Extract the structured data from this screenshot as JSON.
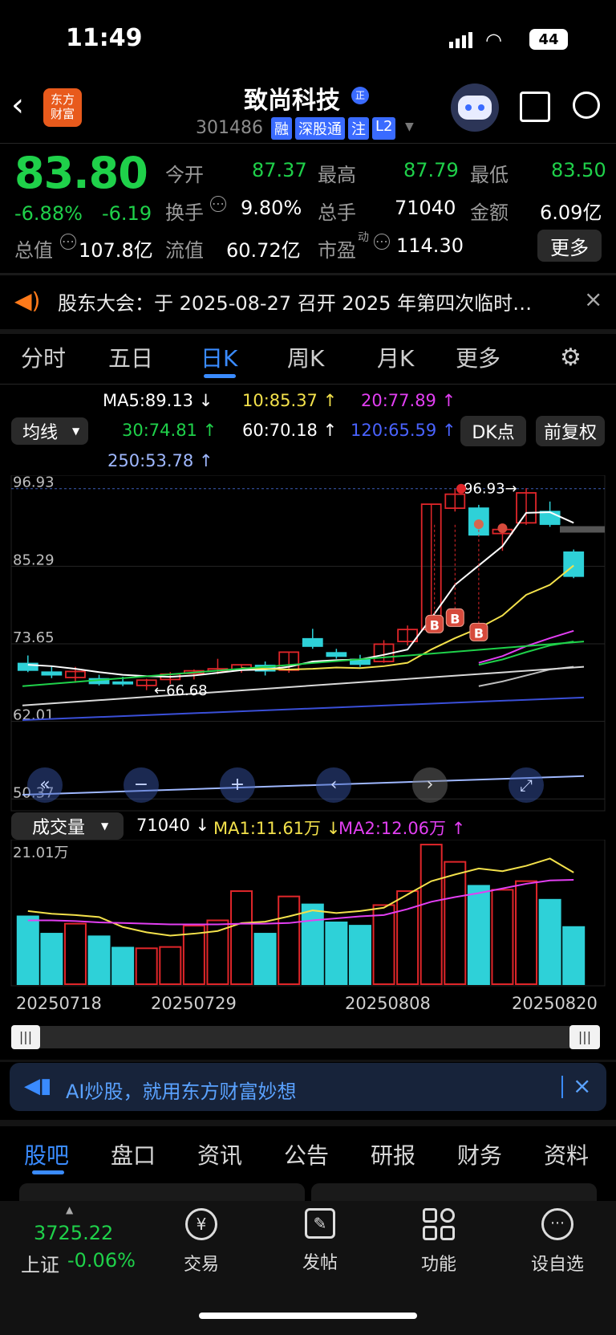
{
  "status": {
    "time": "11:49",
    "battery": "44"
  },
  "header": {
    "title": "致尚科技",
    "code": "301486",
    "tags": [
      "融",
      "深股通",
      "注",
      "L2"
    ],
    "logo_text": "东方\n财富"
  },
  "quote": {
    "price": "83.80",
    "pct": "-6.88%",
    "chg": "-6.19",
    "row1": {
      "k1": "今开",
      "v1": "87.37",
      "k2": "最高",
      "v2": "87.79",
      "k3": "最低",
      "v3": "83.50"
    },
    "row2": {
      "k1": "换手",
      "v1": "9.80%",
      "k2": "总手",
      "v2": "71040",
      "k3": "金额",
      "v3": "6.09亿"
    },
    "row3": {
      "k0": "总值",
      "v0": "107.8亿",
      "k1": "流值",
      "v1": "60.72亿",
      "k2": "市盈",
      "sup": "动",
      "v2": "114.30"
    },
    "more": "更多"
  },
  "notice": "股东大会：于 2025-08-27 召开 2025 年第四次临时…",
  "tabs": [
    "分时",
    "五日",
    "日K",
    "周K",
    "月K",
    "更多"
  ],
  "ma": {
    "sel": "均线",
    "ma5": "MA5:89.13",
    "ma10": "10:85.37",
    "ma20": "20:77.89",
    "ma30": "30:74.81",
    "ma60": "60:70.18",
    "ma120": "120:65.59",
    "ma250": "250:53.78"
  },
  "chart_btns": {
    "dk": "DK点",
    "fq": "前复权"
  },
  "volume": {
    "sel": "成交量",
    "v": "71040",
    "ma1": "MA1:11.61万",
    "ma2": "MA2:12.06万",
    "max": "21.01万"
  },
  "xlabels": [
    "20250718",
    "20250729",
    "20250808",
    "20250820"
  ],
  "ad": "AI炒股，就用东方财富妙想",
  "bottom_tabs": [
    "股吧",
    "盘口",
    "资讯",
    "公告",
    "研报",
    "财务",
    "资料"
  ],
  "index": {
    "value": "3725.22",
    "name": "上证",
    "pct": "-0.06%"
  },
  "nav": [
    "交易",
    "发帖",
    "功能",
    "设自选"
  ],
  "colors": {
    "up": "#e0262a",
    "down": "#2ed1d8",
    "accent_blue": "#3a8bff",
    "green": "#1fd14a"
  },
  "chart_data": {
    "type": "candlestick",
    "y_ticks": [
      "96.93",
      "85.29",
      "73.65",
      "62.01",
      "50.37"
    ],
    "annotations": [
      "96.93→",
      "←66.68",
      "B",
      "B",
      "B"
    ],
    "x_ticks": [
      "20250718",
      "20250729",
      "20250808",
      "20250820"
    ],
    "candles": [
      {
        "o": 70.7,
        "h": 71.9,
        "l": 69.4,
        "c": 69.7,
        "d": "down"
      },
      {
        "o": 69.4,
        "h": 70.2,
        "l": 68.5,
        "c": 69.0,
        "d": "down"
      },
      {
        "o": 68.6,
        "h": 70.2,
        "l": 67.8,
        "c": 69.5,
        "d": "up"
      },
      {
        "o": 68.4,
        "h": 69.0,
        "l": 67.4,
        "c": 67.7,
        "d": "down"
      },
      {
        "o": 67.8,
        "h": 68.7,
        "l": 67.3,
        "c": 67.9,
        "d": "down"
      },
      {
        "o": 67.4,
        "h": 68.4,
        "l": 66.7,
        "c": 68.2,
        "d": "up"
      },
      {
        "o": 68.3,
        "h": 69.4,
        "l": 67.6,
        "c": 69.1,
        "d": "up"
      },
      {
        "o": 69.2,
        "h": 69.8,
        "l": 68.3,
        "c": 69.6,
        "d": "up"
      },
      {
        "o": 69.6,
        "h": 71.4,
        "l": 69.1,
        "c": 69.9,
        "d": "up"
      },
      {
        "o": 69.8,
        "h": 70.6,
        "l": 69.3,
        "c": 70.5,
        "d": "up"
      },
      {
        "o": 70.4,
        "h": 71.0,
        "l": 68.9,
        "c": 69.6,
        "d": "down"
      },
      {
        "o": 69.7,
        "h": 72.5,
        "l": 69.3,
        "c": 72.4,
        "d": "up"
      },
      {
        "o": 74.4,
        "h": 75.9,
        "l": 72.9,
        "c": 73.3,
        "d": "down"
      },
      {
        "o": 72.3,
        "h": 72.9,
        "l": 71.4,
        "c": 71.8,
        "d": "down"
      },
      {
        "o": 71.3,
        "h": 72.0,
        "l": 70.2,
        "c": 70.6,
        "d": "down"
      },
      {
        "o": 71.0,
        "h": 74.2,
        "l": 70.8,
        "c": 73.6,
        "d": "up"
      },
      {
        "o": 74.0,
        "h": 76.4,
        "l": 73.4,
        "c": 75.8,
        "d": "up"
      },
      {
        "o": 75.8,
        "h": 94.6,
        "l": 75.4,
        "c": 94.6,
        "d": "up"
      },
      {
        "o": 94.0,
        "h": 96.9,
        "l": 93.5,
        "c": 96.1,
        "d": "up"
      },
      {
        "o": 94.0,
        "h": 94.5,
        "l": 89.8,
        "c": 90.0,
        "d": "down"
      },
      {
        "o": 90.2,
        "h": 91.3,
        "l": 87.6,
        "c": 90.8,
        "d": "up"
      },
      {
        "o": 91.8,
        "h": 97.0,
        "l": 91.5,
        "c": 96.3,
        "d": "up"
      },
      {
        "o": 93.5,
        "h": 95.0,
        "l": 91.2,
        "c": 91.6,
        "d": "down"
      },
      {
        "o": 87.4,
        "h": 87.8,
        "l": 83.5,
        "c": 83.8,
        "d": "down"
      }
    ],
    "ma_lines": [
      {
        "name": "MA5",
        "values": [
          70.5,
          70.3,
          69.9,
          69.4,
          69.0,
          68.8,
          68.7,
          68.9,
          69.3,
          69.7,
          69.8,
          70.2,
          71.0,
          71.2,
          71.3,
          72.0,
          72.8,
          77.5,
          82.5,
          85.4,
          88.3,
          93.3,
          93.4,
          91.8
        ]
      },
      {
        "name": "10",
        "values": [
          null,
          null,
          null,
          null,
          null,
          null,
          null,
          null,
          null,
          70.0,
          69.9,
          69.8,
          69.9,
          70.1,
          70.0,
          70.3,
          70.8,
          72.8,
          74.5,
          76.0,
          77.9,
          81.0,
          82.5,
          85.4
        ]
      },
      {
        "name": "20",
        "values": [
          null,
          null,
          null,
          null,
          null,
          null,
          null,
          null,
          null,
          null,
          null,
          null,
          null,
          null,
          null,
          null,
          null,
          null,
          null,
          70.8,
          71.8,
          73.3,
          74.5,
          75.6
        ]
      },
      {
        "name": "30",
        "values": [
          null,
          null,
          null,
          null,
          null,
          null,
          null,
          null,
          null,
          null,
          null,
          null,
          null,
          null,
          null,
          null,
          null,
          null,
          null,
          70.5,
          71.3,
          72.4,
          73.4,
          74.0
        ]
      },
      {
        "name": "60",
        "values": [
          null,
          null,
          null,
          null,
          null,
          null,
          null,
          null,
          null,
          null,
          null,
          null,
          null,
          null,
          null,
          null,
          null,
          null,
          null,
          67.3,
          68.0,
          68.9,
          69.8,
          70.2
        ]
      },
      {
        "name": "120",
        "values": [
          null,
          null,
          null,
          null,
          null,
          null,
          null,
          null,
          null,
          null,
          null,
          null,
          null,
          null,
          null,
          null,
          null,
          null,
          null,
          null,
          null,
          null,
          null,
          65.6
        ]
      },
      {
        "name": "250",
        "values": [
          null,
          null,
          null,
          null,
          null,
          null,
          null,
          null,
          null,
          null,
          null,
          null,
          null,
          null,
          null,
          null,
          null,
          null,
          null,
          null,
          null,
          null,
          null,
          53.8
        ]
      }
    ],
    "volume": [
      10.2,
      7.6,
      9.1,
      7.2,
      5.5,
      5.4,
      5.6,
      8.8,
      9.6,
      14.0,
      7.6,
      13.2,
      12.0,
      9.3,
      8.8,
      11.9,
      14.0,
      21.0,
      18.4,
      14.8,
      14.2,
      15.5,
      12.7,
      8.6
    ],
    "vol_ma1": [
      11.0,
      10.6,
      10.4,
      10.1,
      8.6,
      7.8,
      7.3,
      7.6,
      8.0,
      9.2,
      9.4,
      10.2,
      11.1,
      10.7,
      11.0,
      11.5,
      13.5,
      15.5,
      16.5,
      17.4,
      17.0,
      17.8,
      18.9,
      16.8
    ],
    "vol_ma2": [
      9.6,
      9.6,
      9.5,
      9.3,
      9.2,
      9.1,
      9.0,
      9.0,
      9.0,
      9.1,
      9.1,
      9.2,
      9.6,
      9.9,
      10.2,
      10.4,
      11.3,
      12.4,
      13.1,
      13.7,
      14.4,
      15.1,
      15.6,
      15.7
    ]
  }
}
